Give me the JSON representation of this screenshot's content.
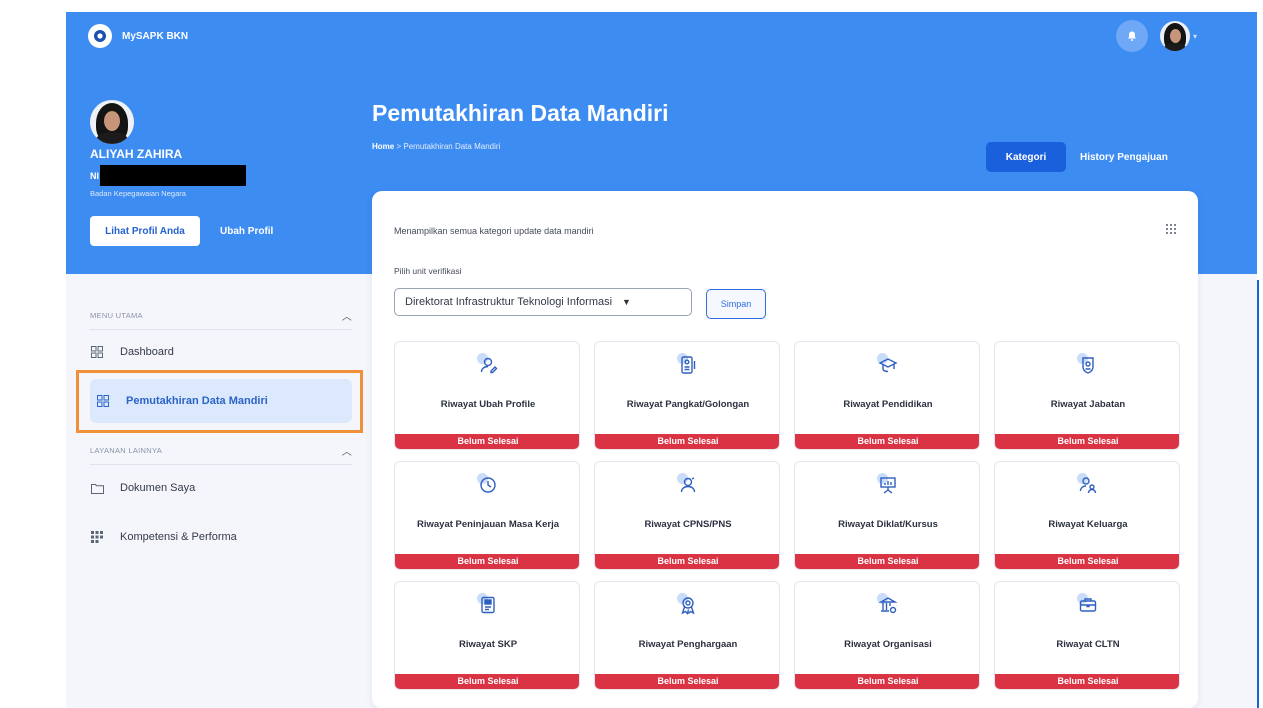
{
  "app": {
    "brand": "MySAPK BKN"
  },
  "profile": {
    "name": "ALIYAH ZAHIRA",
    "nip_prefix": "NI",
    "org": "Badan Kepegawaian Negara",
    "btn_view": "Lihat Profil Anda",
    "btn_edit": "Ubah Profil"
  },
  "menu": {
    "section_main": "MENU UTAMA",
    "section_other": "LAYANAN LAINNYA",
    "items": [
      {
        "label": "Dashboard"
      },
      {
        "label": "Pemutakhiran Data Mandiri"
      },
      {
        "label": "Dokumen Saya"
      },
      {
        "label": "Kompetensi & Performa"
      }
    ]
  },
  "page": {
    "title": "Pemutakhiran Data Mandiri",
    "breadcrumb_home": "Home",
    "breadcrumb_sep": ">",
    "breadcrumb_current": "Pemutakhiran Data Mandiri",
    "tab_kategori": "Kategori",
    "tab_history": "History Pengajuan"
  },
  "card": {
    "description": "Menampilkan semua kategori update data mandiri",
    "unit_label": "Pilih unit verifikasi",
    "unit_selected": "Direktorat Infrastruktur Teknologi Informasi",
    "save_label": "Simpan"
  },
  "tiles": [
    {
      "title": "Riwayat Ubah Profile",
      "status": "Belum Selesai",
      "icon": "profile-edit-icon"
    },
    {
      "title": "Riwayat Pangkat/Golongan",
      "status": "Belum Selesai",
      "icon": "id-card-icon"
    },
    {
      "title": "Riwayat Pendidikan",
      "status": "Belum Selesai",
      "icon": "graduation-cap-icon"
    },
    {
      "title": "Riwayat Jabatan",
      "status": "Belum Selesai",
      "icon": "badge-icon"
    },
    {
      "title": "Riwayat Peninjauan Masa Kerja",
      "status": "Belum Selesai",
      "icon": "clock-icon"
    },
    {
      "title": "Riwayat CPNS/PNS",
      "status": "Belum Selesai",
      "icon": "person-icon"
    },
    {
      "title": "Riwayat Diklat/Kursus",
      "status": "Belum Selesai",
      "icon": "presentation-board-icon"
    },
    {
      "title": "Riwayat Keluarga",
      "status": "Belum Selesai",
      "icon": "family-icon"
    },
    {
      "title": "Riwayat SKP",
      "status": "Belum Selesai",
      "icon": "document-icon"
    },
    {
      "title": "Riwayat Penghargaan",
      "status": "Belum Selesai",
      "icon": "award-ribbon-icon"
    },
    {
      "title": "Riwayat Organisasi",
      "status": "Belum Selesai",
      "icon": "building-gear-icon"
    },
    {
      "title": "Riwayat CLTN",
      "status": "Belum Selesai",
      "icon": "briefcase-icon"
    }
  ],
  "colors": {
    "primary": "#3d8cf2",
    "accent": "#1a5fdc",
    "status_red": "#d93344",
    "highlight": "#f0913a"
  }
}
